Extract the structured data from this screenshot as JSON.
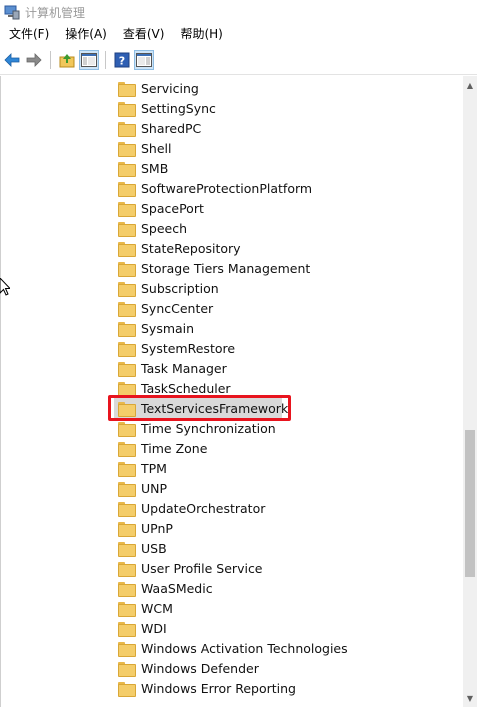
{
  "window": {
    "title": "计算机管理"
  },
  "menu": {
    "file": "文件(F)",
    "action": "操作(A)",
    "view": "查看(V)",
    "help": "帮助(H)"
  },
  "toolbar": [
    "back-arrow-icon",
    "forward-arrow-icon",
    "up-folder-icon",
    "show-hide-tree-icon",
    "help-icon",
    "show-hide-action-pane-icon"
  ],
  "tree": {
    "items": [
      "Servicing",
      "SettingSync",
      "SharedPC",
      "Shell",
      "SMB",
      "SoftwareProtectionPlatform",
      "SpacePort",
      "Speech",
      "StateRepository",
      "Storage Tiers Management",
      "Subscription",
      "SyncCenter",
      "Sysmain",
      "SystemRestore",
      "Task Manager",
      "TaskScheduler",
      "TextServicesFramework",
      "Time Synchronization",
      "Time Zone",
      "TPM",
      "UNP",
      "UpdateOrchestrator",
      "UPnP",
      "USB",
      "User Profile Service",
      "WaaSMedic",
      "WCM",
      "WDI",
      "Windows Activation Technologies",
      "Windows Defender",
      "Windows Error Reporting"
    ],
    "selected": "TextServicesFramework"
  },
  "colors": {
    "highlight": "#e8141e",
    "folder": "#f4cd6a",
    "selection": "#d9d9d9"
  }
}
